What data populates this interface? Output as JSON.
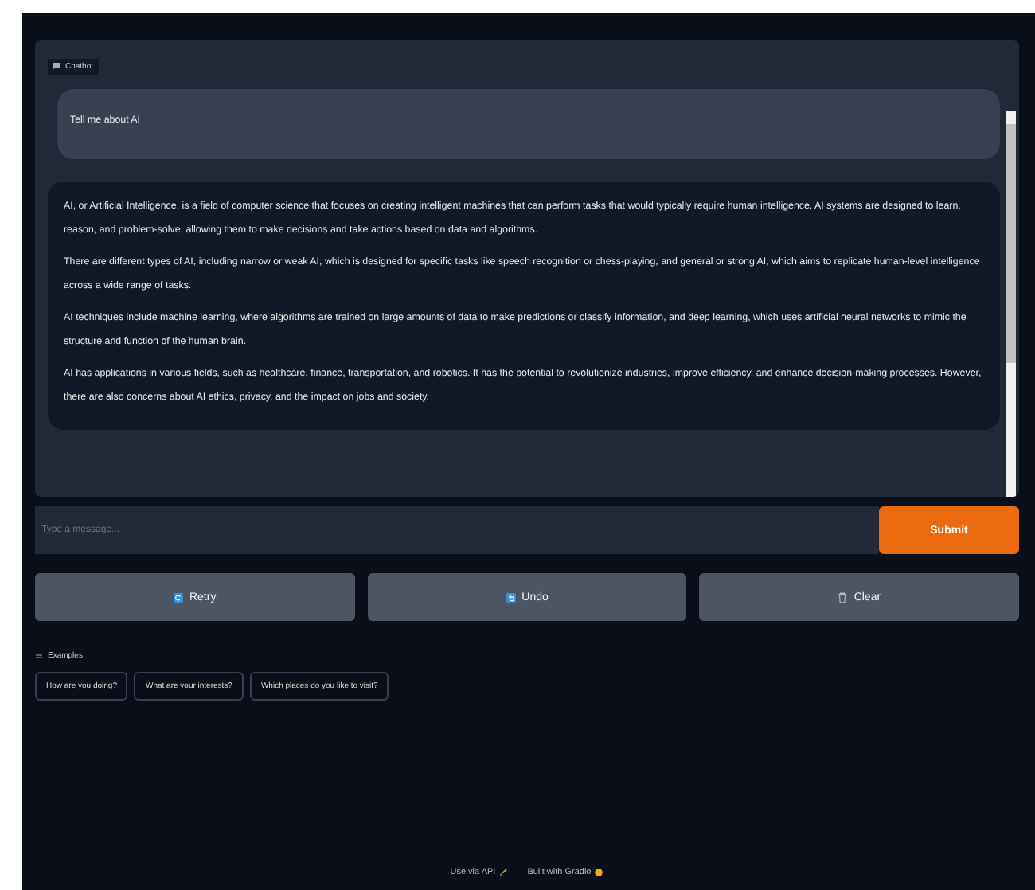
{
  "chatbot": {
    "label": "Chatbot",
    "messages": [
      {
        "kind": "user",
        "paragraphs": [
          "Tell me about AI"
        ]
      },
      {
        "kind": "bot",
        "paragraphs": [
          "AI, or Artificial Intelligence, is a field of computer science that focuses on creating intelligent machines that can perform tasks that would typically require human intelligence. AI systems are designed to learn, reason, and problem-solve, allowing them to make decisions and take actions based on data and algorithms.",
          "There are different types of AI, including narrow or weak AI, which is designed for specific tasks like speech recognition or chess-playing, and general or strong AI, which aims to replicate human-level intelligence across a wide range of tasks.",
          "AI techniques include machine learning, where algorithms are trained on large amounts of data to make predictions or classify information, and deep learning, which uses artificial neural networks to mimic the structure and function of the human brain.",
          "AI has applications in various fields, such as healthcare, finance, transportation, and robotics. It has the potential to revolutionize industries, improve efficiency, and enhance decision-making processes. However, there are also concerns about AI ethics, privacy, and the impact on jobs and society."
        ]
      }
    ]
  },
  "input": {
    "placeholder": "Type a message..."
  },
  "submit": "Submit",
  "actions": [
    {
      "kind": "retry",
      "label": "Retry"
    },
    {
      "kind": "undo",
      "label": "Undo"
    },
    {
      "kind": "clear",
      "label": "Clear"
    }
  ],
  "examples": {
    "label": "Examples",
    "items": [
      "How are you doing?",
      "What are your interests?",
      "Which places do you like to visit?"
    ]
  },
  "footer": {
    "api": "Use via API",
    "built": "Built with Gradio"
  }
}
